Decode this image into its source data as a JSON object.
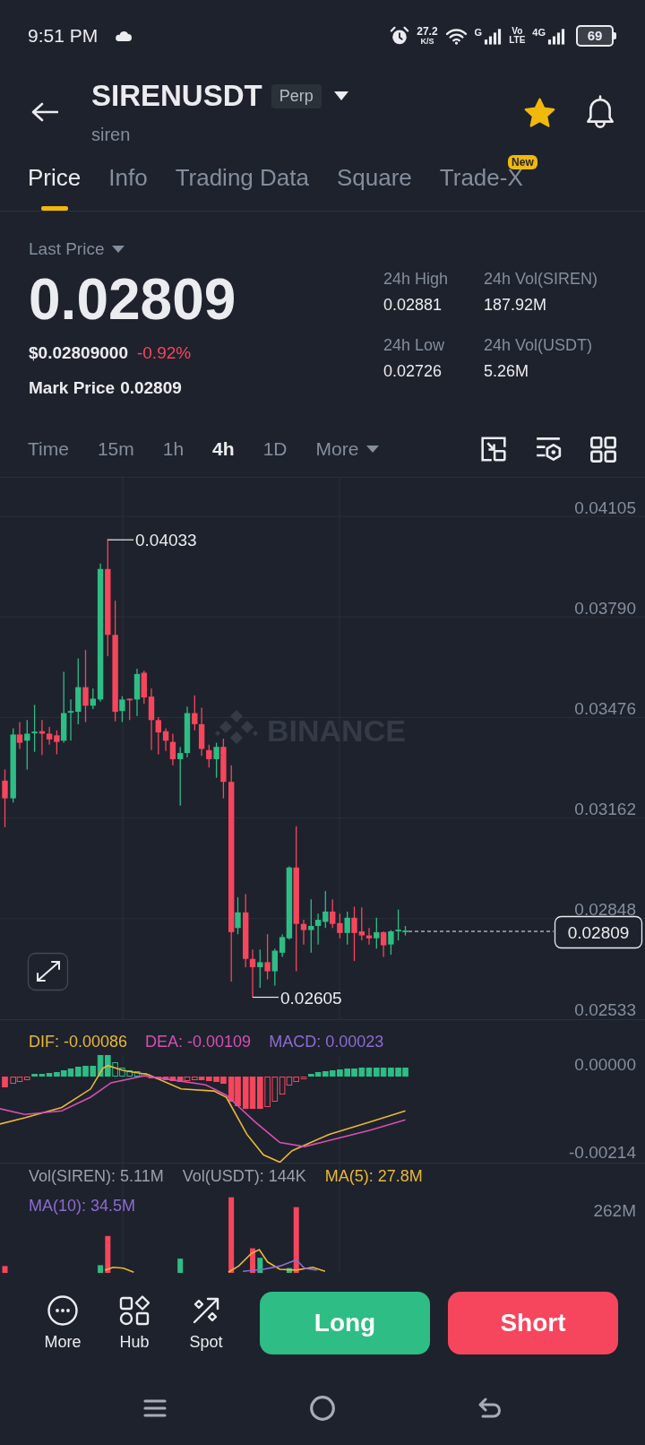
{
  "status_bar": {
    "time": "9:51 PM",
    "net_speed": "27.2",
    "net_speed_unit": "K/S",
    "network_1": "G",
    "volte_top": "Vo",
    "volte_bottom": "LTE",
    "network_2": "4G",
    "battery": "69"
  },
  "header": {
    "symbol": "SIRENUSDT",
    "contract": "Perp",
    "subtitle": "siren",
    "favorite": true
  },
  "tabs": [
    {
      "label": "Price",
      "selected": true
    },
    {
      "label": "Info",
      "selected": false
    },
    {
      "label": "Trading Data",
      "selected": false
    },
    {
      "label": "Square",
      "selected": false
    },
    {
      "label": "Trade-X",
      "selected": false,
      "badge": "New"
    }
  ],
  "ticker": {
    "price_type": "Last Price",
    "last_price": "0.02809",
    "usd_price": "$0.02809000",
    "change": "-0.92%",
    "mark_price_label": "Mark Price",
    "mark_price": "0.02809",
    "stats": [
      {
        "label": "24h High",
        "value": "0.02881"
      },
      {
        "label": "24h Vol(SIREN)",
        "value": "187.92M"
      },
      {
        "label": "24h Low",
        "value": "0.02726"
      },
      {
        "label": "24h Vol(USDT)",
        "value": "5.26M"
      }
    ]
  },
  "intervals": [
    {
      "label": "Time",
      "kind": "option",
      "selected": false
    },
    {
      "label": "15m",
      "kind": "option",
      "selected": false
    },
    {
      "label": "1h",
      "kind": "option",
      "selected": false
    },
    {
      "label": "4h",
      "kind": "option",
      "selected": true
    },
    {
      "label": "1D",
      "kind": "option",
      "selected": false
    },
    {
      "label": "More",
      "kind": "dropdown",
      "selected": false
    }
  ],
  "price_chart": {
    "axis_labels": [
      "0.04105",
      "0.03790",
      "0.03476",
      "0.03162",
      "0.02848",
      "0.02533"
    ],
    "high_label": "0.04033",
    "low_label": "0.02605",
    "current_price": "0.02809",
    "watermark": "BINANCE"
  },
  "macd": {
    "legend": [
      {
        "text": "DIF: -0.00086",
        "color": "#e8b935"
      },
      {
        "text": "DEA: -0.00109",
        "color": "#d64fb3"
      },
      {
        "text": "MACD: 0.00023",
        "color": "#8e6bd0"
      }
    ],
    "axis_labels": [
      "0.00000",
      "-0.00214"
    ]
  },
  "volume": {
    "legend": [
      {
        "text": "Vol(SIREN): 5.11M",
        "color": "#9aa1ab"
      },
      {
        "text": "Vol(USDT): 144K",
        "color": "#9aa1ab"
      },
      {
        "text": "MA(5): 27.8M",
        "color": "#e8b935"
      },
      {
        "text": "MA(10): 34.5M",
        "color": "#8e6bd0"
      }
    ],
    "axis_label": "262M"
  },
  "actions": [
    {
      "label": "More",
      "kind": "more"
    },
    {
      "label": "Hub",
      "kind": "hub"
    },
    {
      "label": "Spot",
      "kind": "spot"
    }
  ],
  "trade_buttons": [
    {
      "label": "Long",
      "kind": "long"
    },
    {
      "label": "Short",
      "kind": "short"
    }
  ]
}
